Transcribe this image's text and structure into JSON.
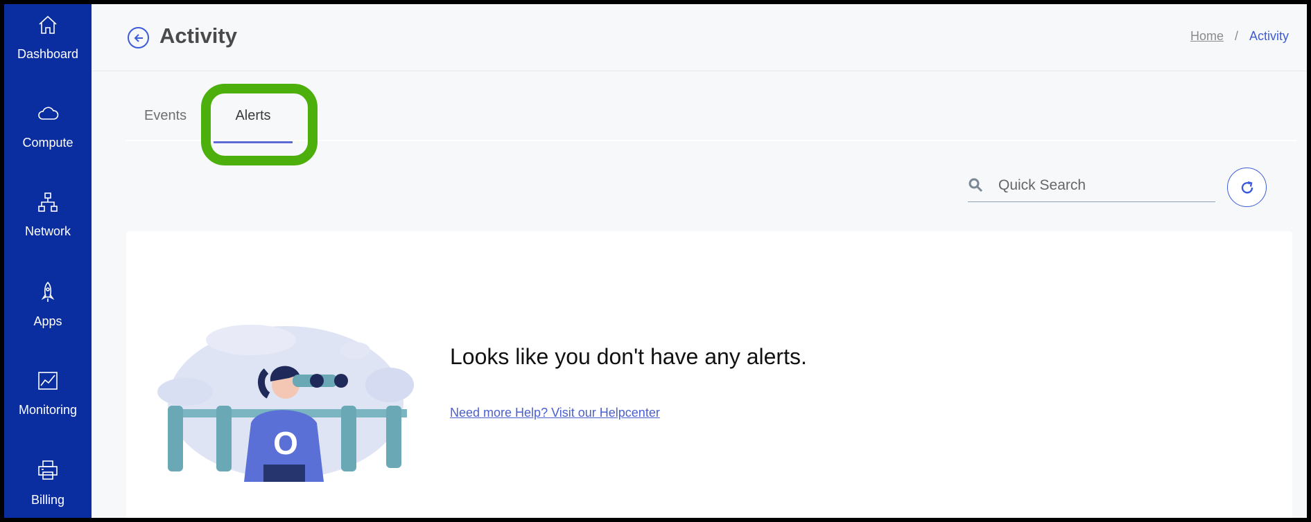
{
  "sidebar": {
    "items": [
      {
        "label": "Dashboard",
        "icon": "home-icon"
      },
      {
        "label": "Compute",
        "icon": "cloud-icon"
      },
      {
        "label": "Network",
        "icon": "network-icon"
      },
      {
        "label": "Apps",
        "icon": "rocket-icon"
      },
      {
        "label": "Monitoring",
        "icon": "chart-icon"
      },
      {
        "label": "Billing",
        "icon": "printer-icon"
      }
    ]
  },
  "header": {
    "title": "Activity",
    "breadcrumb": {
      "home": "Home",
      "separator": "/",
      "current": "Activity"
    }
  },
  "tabs": [
    {
      "label": "Events",
      "active": false
    },
    {
      "label": "Alerts",
      "active": true
    }
  ],
  "search": {
    "placeholder": "Quick Search",
    "value": ""
  },
  "empty_state": {
    "title": "Looks like you don't have any alerts.",
    "help_link": "Need more Help? Visit our Helpcenter",
    "illustration_letter": "O"
  },
  "colors": {
    "sidebar": "#0a2ea0",
    "accent": "#3b5bdb",
    "highlight": "#4caf0c"
  }
}
